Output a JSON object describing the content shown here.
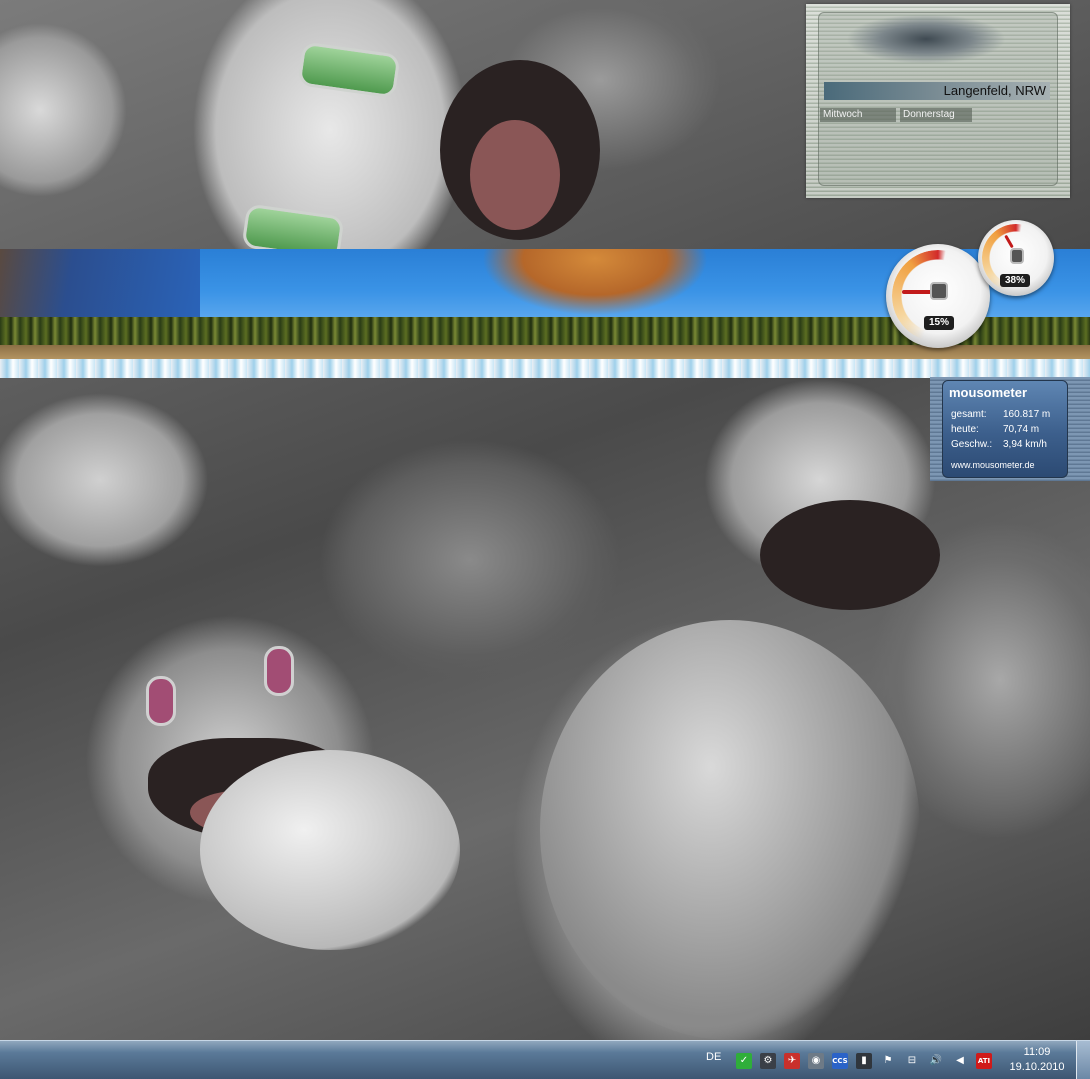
{
  "weather": {
    "location": "Langenfeld, NRW",
    "days": [
      "Mittwoch",
      "Donnerstag"
    ]
  },
  "cpu_meter": {
    "cpu_percent": "15%",
    "memory_percent": "38%"
  },
  "mousometer": {
    "title": "mousometer",
    "rows": [
      {
        "label": "gesamt:",
        "value": "160.817 m"
      },
      {
        "label": "heute:",
        "value": "70,74 m"
      },
      {
        "label": "Geschw.:",
        "value": "3,94 km/h"
      }
    ],
    "url": "www.mousometer.de"
  },
  "taskbar": {
    "language": "DE",
    "tray_icons": [
      {
        "name": "security-shield-icon",
        "glyph": "✓",
        "color": "#2fae3a"
      },
      {
        "name": "steam-icon",
        "glyph": "⚙",
        "color": "#3a3f47"
      },
      {
        "name": "flashget-icon",
        "glyph": "✈",
        "color": "#c9302c"
      },
      {
        "name": "disk-icon",
        "glyph": "◉",
        "color": "#6e7a86"
      },
      {
        "name": "ccs-icon",
        "glyph": "CCS",
        "color": "#2b63c8"
      },
      {
        "name": "monitor-tool-icon",
        "glyph": "▮",
        "color": "#30363d"
      },
      {
        "name": "action-center-flag-icon",
        "glyph": "⚑",
        "color": "transparent"
      },
      {
        "name": "network-icon",
        "glyph": "⊟",
        "color": "transparent"
      },
      {
        "name": "volume-icon",
        "glyph": "🔊",
        "color": "transparent"
      },
      {
        "name": "muted-speaker-icon",
        "glyph": "◀",
        "color": "transparent"
      },
      {
        "name": "ati-catalyst-icon",
        "glyph": "ATI",
        "color": "#d01a1a"
      }
    ],
    "time": "11:09",
    "date": "19.10.2010"
  }
}
